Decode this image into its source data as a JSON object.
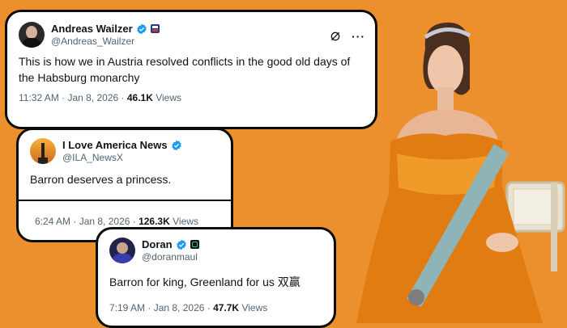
{
  "tweets": [
    {
      "name": "Andreas Wailzer",
      "handle": "@Andreas_Wailzer",
      "text": "This is how we in Austria resolved conflicts in the good old days of the Habsburg monarchy",
      "time": "11:32 AM · Jan 8, 2026 · ",
      "views_count": "46.1K",
      "views_label": " Views",
      "affiliate_badge": "flag-badge-icon"
    },
    {
      "name": "I Love America News",
      "handle": "@ILA_NewsX",
      "text": "Barron deserves a princess.",
      "time": "6:24 AM · Jan 8, 2026 · ",
      "views_count": "126.3K",
      "views_label": " Views"
    },
    {
      "name": "Doran",
      "handle": "@doranmaul",
      "text": "Barron for king, Greenland for us  双赢",
      "time": "7:19 AM · Jan 8, 2026 · ",
      "views_count": "47.7K",
      "views_label": " Views",
      "affiliate_badge": "square-badge-icon"
    }
  ],
  "colors": {
    "background": "#ec8f2d",
    "verified_blue": "#1d9bf0",
    "secondary_text": "#536471"
  },
  "icons": [
    "grok-icon",
    "more-icon",
    "verified-icon"
  ]
}
